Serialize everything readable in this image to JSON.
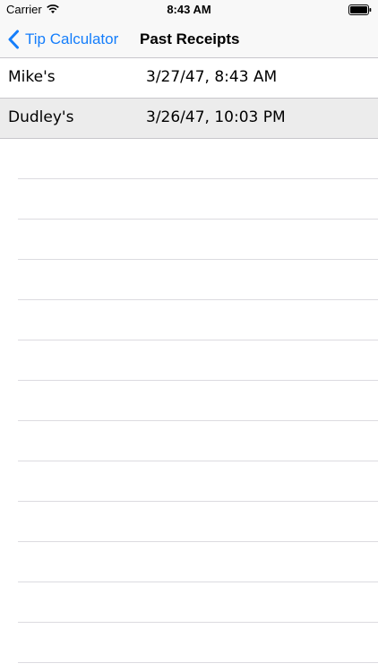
{
  "status_bar": {
    "carrier": "Carrier",
    "time": "8:43 AM",
    "wifi_icon": "wifi-icon",
    "battery_icon": "battery-icon"
  },
  "nav": {
    "back_label": "Tip Calculator",
    "back_icon": "chevron-left-icon",
    "title": "Past Receipts",
    "tint": "#157efb"
  },
  "receipts": [
    {
      "name": "Mike's",
      "date": "3/27/47, 8:43 AM",
      "selected": false
    },
    {
      "name": "Dudley's",
      "date": "3/26/47, 10:03 PM",
      "selected": true
    }
  ]
}
